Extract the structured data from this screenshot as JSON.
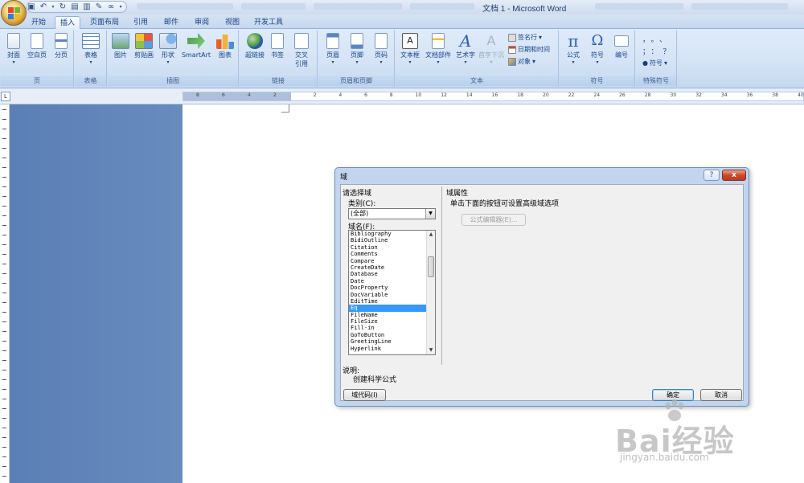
{
  "window": {
    "title": "文档 1 - Microsoft Word"
  },
  "tabs": [
    "开始",
    "插入",
    "页面布局",
    "引用",
    "邮件",
    "审阅",
    "视图",
    "开发工具"
  ],
  "active_tab": "插入",
  "ribbon": {
    "page_group": {
      "label": "页",
      "buttons": [
        "封面",
        "空白页",
        "分页"
      ]
    },
    "table_group": {
      "label": "表格",
      "buttons": [
        "表格"
      ]
    },
    "illustration_group": {
      "label": "插图",
      "buttons": [
        "图片",
        "剪贴画",
        "形状",
        "SmartArt",
        "图表"
      ]
    },
    "link_group": {
      "label": "链接",
      "buttons": [
        "超链接",
        "书签",
        "交叉",
        "引用"
      ]
    },
    "header_footer_group": {
      "label": "页眉和页脚",
      "buttons": [
        "页眉",
        "页脚",
        "页码"
      ]
    },
    "text_group": {
      "label": "文本",
      "buttons": [
        "文本框",
        "文档部件",
        "艺术字",
        "首字下沉"
      ],
      "small_buttons": [
        "签名行",
        "日期和时间",
        "对象"
      ]
    },
    "symbol_group": {
      "label": "符号",
      "buttons": [
        "公式",
        "符号",
        "编号"
      ]
    },
    "special_group": {
      "label": "特殊符号",
      "symbols": [
        "，",
        "。",
        "、",
        "；",
        "：",
        "？"
      ],
      "dropdown": "符号"
    }
  },
  "ruler": {
    "left_marks": [
      "8",
      "6",
      "4",
      "2"
    ],
    "right_marks": [
      "2",
      "4",
      "6",
      "8",
      "10",
      "12",
      "14",
      "16",
      "18",
      "20",
      "22",
      "24",
      "26",
      "28",
      "30",
      "32",
      "34",
      "36",
      "38",
      "40"
    ],
    "corner": "L"
  },
  "dialog": {
    "title": "域",
    "help": "?",
    "close": "x",
    "choose_field": "请选择域",
    "category_label": "类别(C):",
    "category_value": "(全部)",
    "field_name_label": "域名(F):",
    "field_names": [
      "Bibliography",
      "BidiOutline",
      "Citation",
      "Comments",
      "Compare",
      "CreateDate",
      "Database",
      "Date",
      "DocProperty",
      "DocVariable",
      "EditTime",
      "Eq",
      "FileName",
      "FileSize",
      "Fill-in",
      "GoToButton",
      "GreetingLine",
      "Hyperlink"
    ],
    "selected_field": "Eq",
    "field_properties": "域属性",
    "hint": "单击下面的按钮可设置高级域选项",
    "formula_editor": "公式编辑器(E)...",
    "description_label": "说明:",
    "description": "创建科学公式",
    "field_codes_button": "域代码(I)",
    "ok_button": "确定",
    "cancel_button": "取消"
  },
  "watermark": {
    "text": "Bai经验",
    "url": "jingyan.baidu.com"
  }
}
